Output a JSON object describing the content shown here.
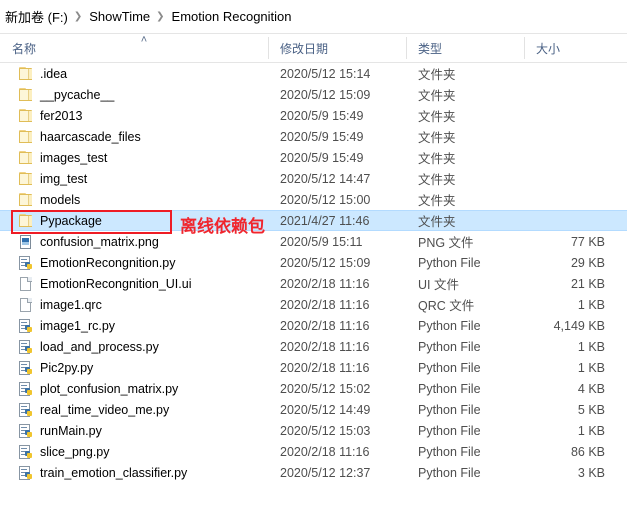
{
  "window": {
    "accent_selection": "#cce8ff",
    "annotation_color": "#f0262e"
  },
  "breadcrumb": {
    "separator": "❯",
    "items": [
      {
        "label": "新加卷 (F:)"
      },
      {
        "label": "ShowTime"
      },
      {
        "label": "Emotion Recognition"
      }
    ]
  },
  "columns": {
    "name": "名称",
    "date": "修改日期",
    "type": "类型",
    "size": "大小",
    "sort_indicator": "˄",
    "sort_column": "名称",
    "sort_direction": "ascending"
  },
  "annotation": {
    "text": "离线依赖包",
    "target_row": "Pypackage"
  },
  "rows": [
    {
      "icon": "folder-icon",
      "name": ".idea",
      "date": "2020/5/12 15:14",
      "type": "文件夹",
      "size": "",
      "selected": false
    },
    {
      "icon": "folder-icon",
      "name": "__pycache__",
      "date": "2020/5/12 15:09",
      "type": "文件夹",
      "size": "",
      "selected": false
    },
    {
      "icon": "folder-icon",
      "name": "fer2013",
      "date": "2020/5/9 15:49",
      "type": "文件夹",
      "size": "",
      "selected": false
    },
    {
      "icon": "folder-icon",
      "name": "haarcascade_files",
      "date": "2020/5/9 15:49",
      "type": "文件夹",
      "size": "",
      "selected": false
    },
    {
      "icon": "folder-icon",
      "name": "images_test",
      "date": "2020/5/9 15:49",
      "type": "文件夹",
      "size": "",
      "selected": false
    },
    {
      "icon": "folder-icon",
      "name": "img_test",
      "date": "2020/5/12 14:47",
      "type": "文件夹",
      "size": "",
      "selected": false
    },
    {
      "icon": "folder-icon",
      "name": "models",
      "date": "2020/5/12 15:00",
      "type": "文件夹",
      "size": "",
      "selected": false
    },
    {
      "icon": "folder-icon",
      "name": "Pypackage",
      "date": "2021/4/27 11:46",
      "type": "文件夹",
      "size": "",
      "selected": true
    },
    {
      "icon": "png-file-icon",
      "name": "confusion_matrix.png",
      "date": "2020/5/9 15:11",
      "type": "PNG 文件",
      "size": "77 KB",
      "selected": false
    },
    {
      "icon": "python-file-icon",
      "name": "EmotionRecongnition.py",
      "date": "2020/5/12 15:09",
      "type": "Python File",
      "size": "29 KB",
      "selected": false
    },
    {
      "icon": "page-file-icon",
      "name": "EmotionRecongnition_UI.ui",
      "date": "2020/2/18 11:16",
      "type": "UI 文件",
      "size": "21 KB",
      "selected": false
    },
    {
      "icon": "page-file-icon",
      "name": "image1.qrc",
      "date": "2020/2/18 11:16",
      "type": "QRC 文件",
      "size": "1 KB",
      "selected": false
    },
    {
      "icon": "python-file-icon",
      "name": "image1_rc.py",
      "date": "2020/2/18 11:16",
      "type": "Python File",
      "size": "4,149 KB",
      "selected": false
    },
    {
      "icon": "python-file-icon",
      "name": "load_and_process.py",
      "date": "2020/2/18 11:16",
      "type": "Python File",
      "size": "1 KB",
      "selected": false
    },
    {
      "icon": "python-file-icon",
      "name": "Pic2py.py",
      "date": "2020/2/18 11:16",
      "type": "Python File",
      "size": "1 KB",
      "selected": false
    },
    {
      "icon": "python-file-icon",
      "name": "plot_confusion_matrix.py",
      "date": "2020/5/12 15:02",
      "type": "Python File",
      "size": "4 KB",
      "selected": false
    },
    {
      "icon": "python-file-icon",
      "name": "real_time_video_me.py",
      "date": "2020/5/12 14:49",
      "type": "Python File",
      "size": "5 KB",
      "selected": false
    },
    {
      "icon": "python-file-icon",
      "name": "runMain.py",
      "date": "2020/5/12 15:03",
      "type": "Python File",
      "size": "1 KB",
      "selected": false
    },
    {
      "icon": "python-file-icon",
      "name": "slice_png.py",
      "date": "2020/2/18 11:16",
      "type": "Python File",
      "size": "86 KB",
      "selected": false
    },
    {
      "icon": "python-file-icon",
      "name": "train_emotion_classifier.py",
      "date": "2020/5/12 12:37",
      "type": "Python File",
      "size": "3 KB",
      "selected": false
    }
  ]
}
